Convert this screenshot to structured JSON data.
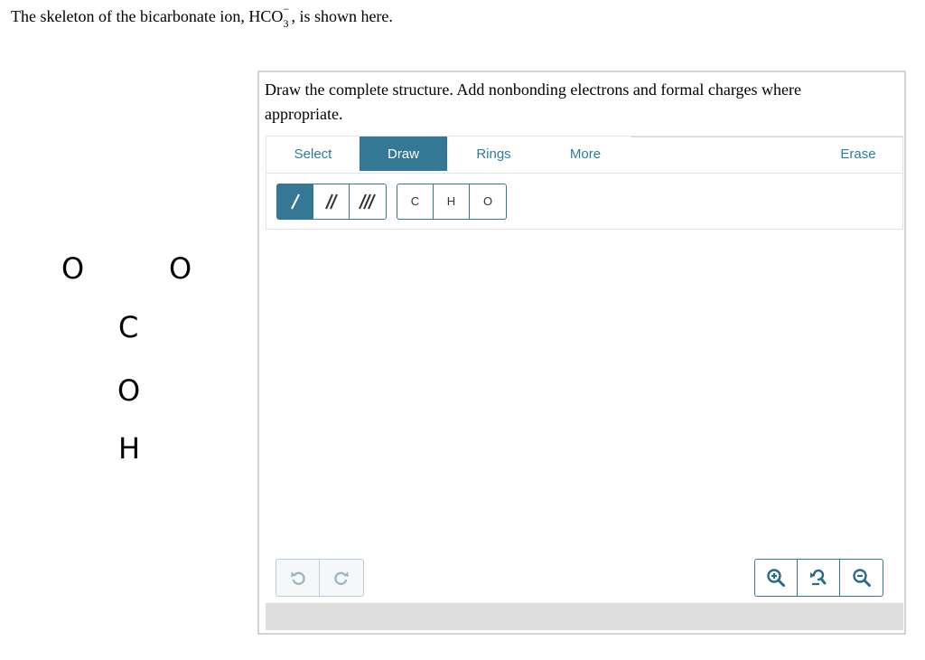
{
  "intro": {
    "text_before": "The skeleton of the bicarbonate ion, ",
    "formula": "HCO",
    "subscript": "3",
    "superscript": "−",
    "text_after": ", is shown here."
  },
  "skeleton": {
    "atoms": [
      "O",
      "O",
      "C",
      "O",
      "H"
    ]
  },
  "instructions": "Draw the complete structure. Add nonbonding electrons and formal charges where appropriate.",
  "tabs": {
    "select": "Select",
    "draw": "Draw",
    "rings": "Rings",
    "more": "More",
    "erase": "Erase",
    "active": "Draw"
  },
  "atoms": {
    "carbon": "C",
    "hydrogen": "H",
    "oxygen": "O"
  },
  "icons": {
    "single_bond": "single-bond-icon",
    "double_bond": "double-bond-icon",
    "triple_bond": "triple-bond-icon",
    "undo": "undo-icon",
    "redo": "redo-icon",
    "zoom_in": "zoom-in-icon",
    "zoom_reset": "zoom-reset-icon",
    "zoom_out": "zoom-out-icon"
  },
  "colors": {
    "accent": "#347895",
    "tab_text": "#2e7d9e",
    "status_bar": "#dedede"
  }
}
